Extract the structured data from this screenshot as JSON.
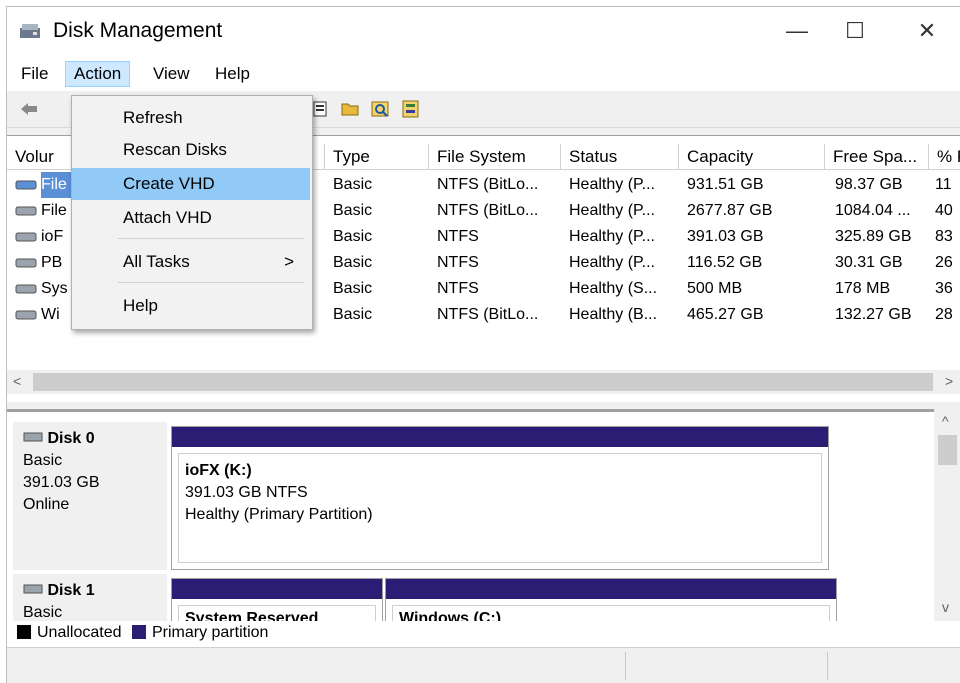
{
  "window": {
    "title": "Disk Management",
    "minimize": "—",
    "maximize": "☐",
    "close": "✕"
  },
  "menubar": {
    "items": [
      "File",
      "Action",
      "View",
      "Help"
    ]
  },
  "action_menu": {
    "items": [
      "Refresh",
      "Rescan Disks",
      "Create VHD",
      "Attach VHD",
      "All Tasks",
      "Help"
    ],
    "submenu_arrow": ">",
    "highlighted": "Create VHD"
  },
  "volume_list": {
    "columns": [
      "Volur",
      "Type",
      "File System",
      "Status",
      "Capacity",
      "Free Spa...",
      "% F"
    ],
    "rows": [
      {
        "name": "File",
        "type": "Basic",
        "fs": "NTFS (BitLo...",
        "status": "Healthy (P...",
        "capacity": "931.51 GB",
        "free": "98.37 GB",
        "pct": "11"
      },
      {
        "name": "File",
        "type": "Basic",
        "fs": "NTFS (BitLo...",
        "status": "Healthy (P...",
        "capacity": "2677.87 GB",
        "free": "1084.04 ...",
        "pct": "40"
      },
      {
        "name": "ioF",
        "type": "Basic",
        "fs": "NTFS",
        "status": "Healthy (P...",
        "capacity": "391.03 GB",
        "free": "325.89 GB",
        "pct": "83"
      },
      {
        "name": "PB",
        "type": "Basic",
        "fs": "NTFS",
        "status": "Healthy (P...",
        "capacity": "116.52 GB",
        "free": "30.31 GB",
        "pct": "26"
      },
      {
        "name": "Sys",
        "type": "Basic",
        "fs": "NTFS",
        "status": "Healthy (S...",
        "capacity": "500 MB",
        "free": "178 MB",
        "pct": "36"
      },
      {
        "name": "Wi",
        "type": "Basic",
        "fs": "NTFS (BitLo...",
        "status": "Healthy (B...",
        "capacity": "465.27 GB",
        "free": "132.27 GB",
        "pct": "28"
      }
    ]
  },
  "scroll": {
    "left": "<",
    "right": ">",
    "up": "^",
    "down": "v"
  },
  "disks": [
    {
      "name": "Disk 0",
      "type": "Basic",
      "size": "391.03 GB",
      "state": "Online",
      "partitions": [
        {
          "title": "ioFX  (K:)",
          "size": "391.03 GB NTFS",
          "status": "Healthy (Primary Partition)"
        }
      ]
    },
    {
      "name": "Disk 1",
      "type": "Basic",
      "size": "",
      "state": "",
      "partitions": [
        {
          "title": "System Reserved"
        },
        {
          "title": "Windows  (C:)"
        }
      ]
    }
  ],
  "legend": {
    "unallocated": "Unallocated",
    "primary": "Primary partition"
  },
  "colors": {
    "primary": "#2b1c74",
    "unallocated": "#000000",
    "highlight": "#91c9f7"
  },
  "icons": [
    "disk-management-icon",
    "back-icon",
    "properties-icon",
    "open-folder-icon",
    "search-icon",
    "settings-icon"
  ]
}
